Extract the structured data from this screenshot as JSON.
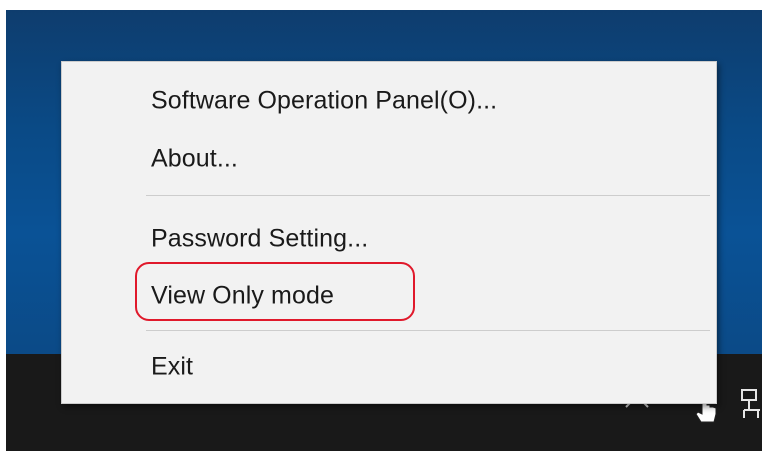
{
  "context_menu": {
    "items": [
      {
        "label": "Software Operation Panel(O)..."
      },
      {
        "label": "About..."
      },
      {
        "label": "Password Setting..."
      },
      {
        "label": "View Only mode"
      },
      {
        "label": "Exit"
      }
    ],
    "highlighted_item": "View Only mode",
    "highlight_color": "#e0192b"
  },
  "taskbar": {
    "tray_icons": [
      "chevron-up-icon",
      "scanner-app-icon",
      "network-icon"
    ],
    "background_color": "#191919"
  },
  "desktop": {
    "background_color": "#0a4a86"
  }
}
